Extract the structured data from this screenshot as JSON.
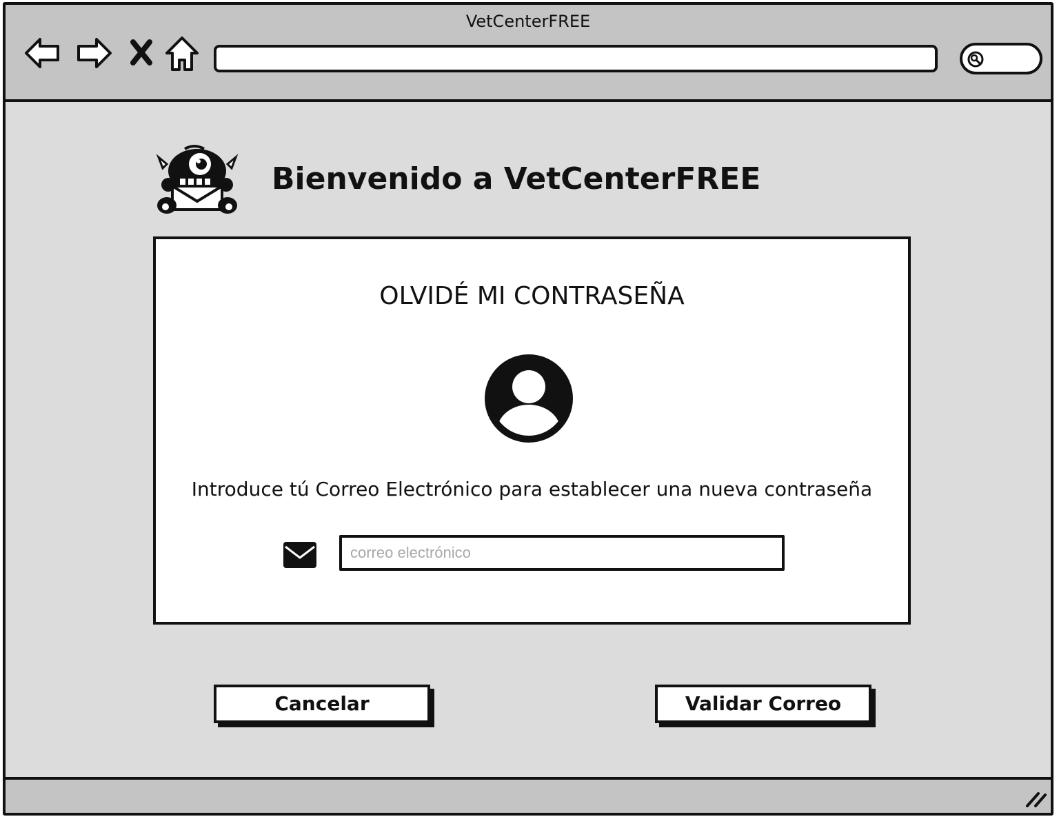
{
  "window": {
    "title": "VetCenterFREE"
  },
  "toolbar": {
    "icons": [
      "back-arrow-icon",
      "forward-arrow-icon",
      "close-x-icon",
      "home-icon",
      "search-icon"
    ],
    "address_value": ""
  },
  "header": {
    "logo_icon": "monster-mail-logo-icon",
    "welcome_text": "Bienvenido a VetCenterFREE"
  },
  "panel": {
    "title": "OLVIDÉ MI CONTRASEÑA",
    "avatar_icon": "user-circle-icon",
    "instruction": "Introduce tú Correo Electrónico para establecer una nueva contraseña",
    "email_icon": "envelope-icon",
    "email_value": "",
    "email_placeholder": "correo electrónico"
  },
  "actions": {
    "cancel_label": "Cancelar",
    "validate_label": "Validar Correo"
  },
  "colors": {
    "chrome": "#c4c4c4",
    "page_bg": "#dcdcdc",
    "panel_bg": "#ffffff",
    "ink": "#111111",
    "placeholder": "#a8a8a8"
  }
}
